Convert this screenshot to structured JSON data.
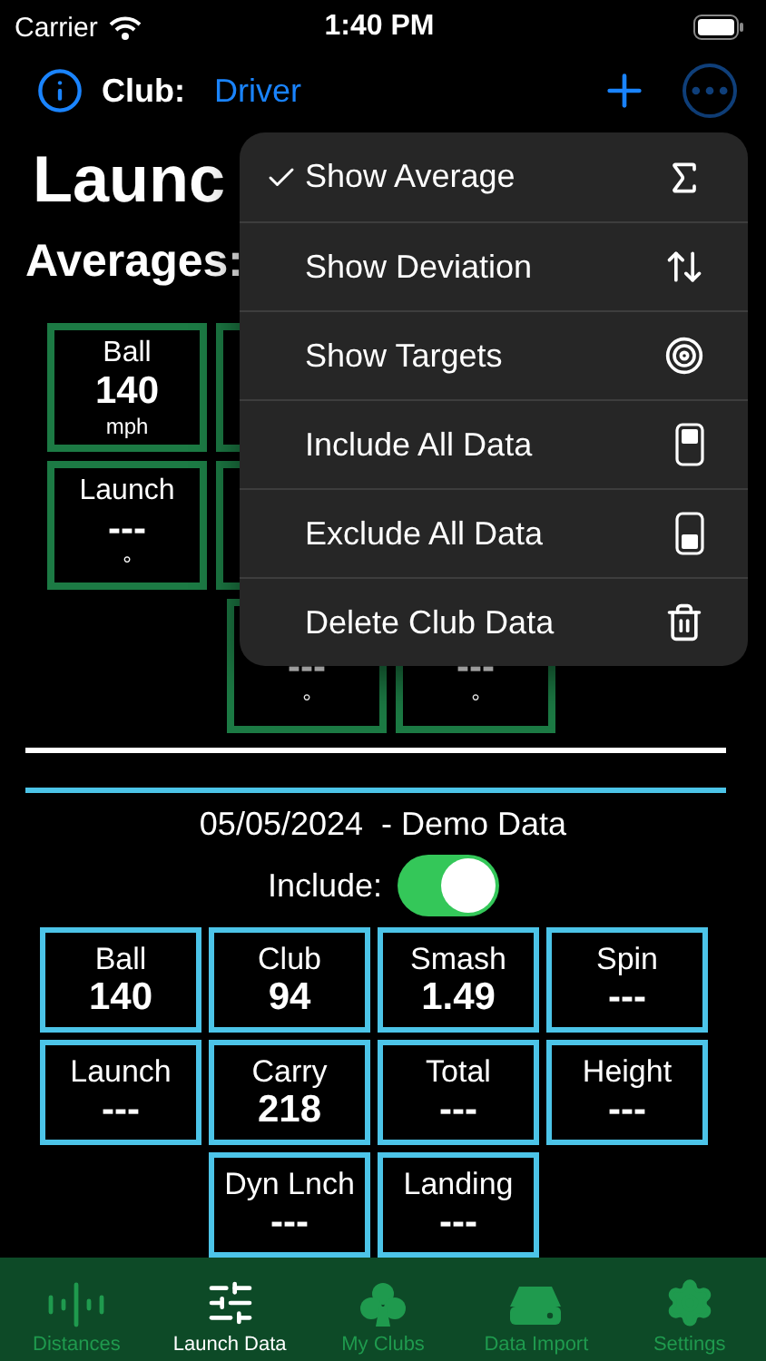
{
  "status_bar": {
    "carrier": "Carrier",
    "time": "1:40 PM"
  },
  "nav": {
    "club_label": "Club:",
    "club_value": "Driver"
  },
  "title": "Launc",
  "averages": {
    "heading": "Averages:",
    "rows": [
      [
        {
          "label": "Ball",
          "value": "140",
          "unit": "mph"
        },
        {}
      ],
      [
        {
          "label": "Launch",
          "value": "---",
          "unit": "°"
        },
        {}
      ],
      [
        {
          "value": "---",
          "unit": "°"
        },
        {
          "value": "---",
          "unit": "°"
        }
      ]
    ]
  },
  "menu": [
    {
      "label": "Show Average",
      "checked": true
    },
    {
      "label": "Show Deviation",
      "checked": false
    },
    {
      "label": "Show Targets",
      "checked": false
    },
    {
      "label": "Include All Data",
      "checked": false
    },
    {
      "label": "Exclude All Data",
      "checked": false
    },
    {
      "label": "Delete Club Data",
      "checked": false
    }
  ],
  "session": {
    "date": "05/05/2024",
    "name": "- Demo Data",
    "include_label": "Include:",
    "include_on": true,
    "rows": [
      [
        {
          "label": "Ball",
          "value": "140"
        },
        {
          "label": "Club",
          "value": "94"
        },
        {
          "label": "Smash",
          "value": "1.49"
        },
        {
          "label": "Spin",
          "value": "---"
        }
      ],
      [
        {
          "label": "Launch",
          "value": "---"
        },
        {
          "label": "Carry",
          "value": "218"
        },
        {
          "label": "Total",
          "value": "---"
        },
        {
          "label": "Height",
          "value": "---"
        }
      ],
      [
        "",
        {
          "label": "Dyn Lnch",
          "value": "---"
        },
        {
          "label": "Landing",
          "value": "---"
        }
      ]
    ]
  },
  "tabs": [
    {
      "label": "Distances",
      "selected": false
    },
    {
      "label": "Launch Data",
      "selected": true
    },
    {
      "label": "My Clubs",
      "selected": false
    },
    {
      "label": "Data Import",
      "selected": false
    },
    {
      "label": "Settings",
      "selected": false
    }
  ]
}
